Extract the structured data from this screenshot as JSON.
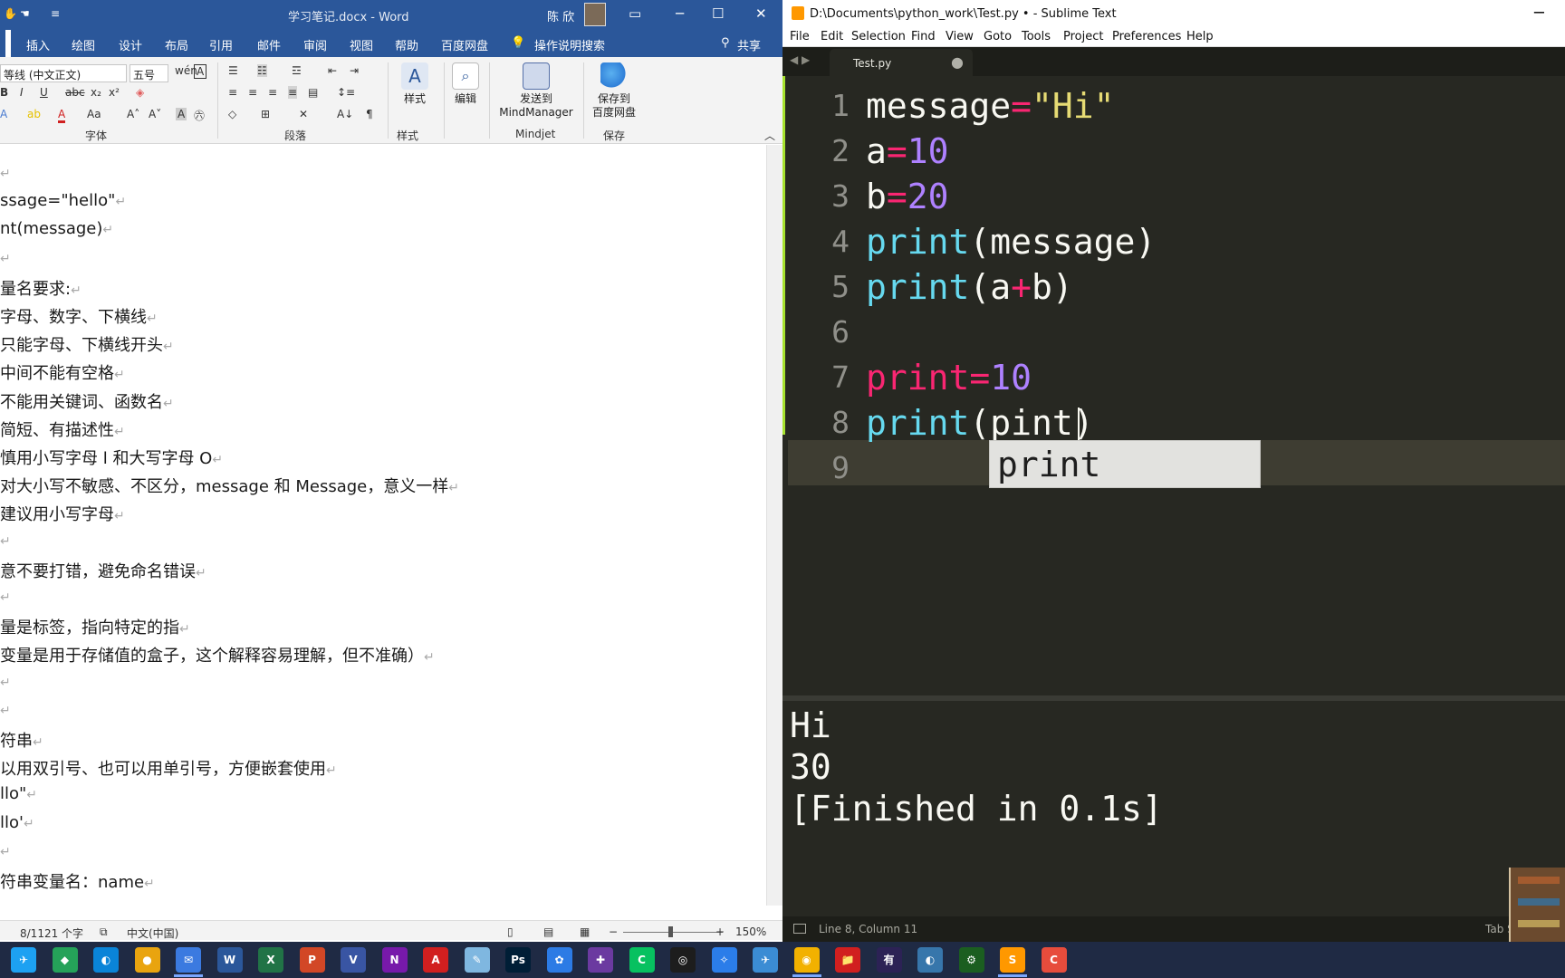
{
  "word": {
    "title": "学习笔记.docx  -  Word",
    "user": "陈 欣",
    "tabs": [
      "插入",
      "绘图",
      "设计",
      "布局",
      "引用",
      "邮件",
      "审阅",
      "视图",
      "帮助",
      "百度网盘",
      "操作说明搜索",
      "共享"
    ],
    "ribbon": {
      "font_name": "等线 (中文正文)",
      "font_size": "五号",
      "group_font": "字体",
      "group_paragraph": "段落",
      "group_styles": "样式",
      "styles_btn": "样式",
      "edit_btn": "编辑",
      "mindmanager_btn_line1": "发送到",
      "mindmanager_btn_line2": "MindManager",
      "group_mindjet": "Mindjet",
      "baidu_btn_line1": "保存到",
      "baidu_btn_line2": "百度网盘",
      "group_save": "保存"
    },
    "doc_lines": [
      "",
      "ssage=\"hello\"",
      "nt(message)",
      "",
      "量名要求:",
      "  字母、数字、下横线",
      "  只能字母、下横线开头",
      "  中间不能有空格",
      "  不能用关键词、函数名",
      "  简短、有描述性",
      "  慎用小写字母 l 和大写字母 O",
      "  对大小写不敏感、不区分，message 和 Message，意义一样",
      "  建议用小写字母",
      "",
      "意不要打错，避免命名错误",
      "",
      "量是标签，指向特定的指",
      "变量是用于存储值的盒子，这个解释容易理解，但不准确）",
      "",
      "",
      "符串",
      "以用双引号、也可以用单引号，方便嵌套使用",
      "llo\"",
      "llo'",
      "",
      "符串变量名：name"
    ],
    "status": {
      "words": "8/1121 个字",
      "lang": "中文(中国)",
      "zoom": "150%",
      "zoom_minus": "−",
      "zoom_plus": "+"
    }
  },
  "sublime": {
    "title": "D:\\Documents\\python_work\\Test.py • - Sublime Text",
    "menu": [
      "File",
      "Edit",
      "Selection",
      "Find",
      "View",
      "Goto",
      "Tools",
      "Project",
      "Preferences",
      "Help"
    ],
    "tab_name": "Test.py",
    "tab_dirty": "●",
    "line_numbers": [
      "1",
      "2",
      "3",
      "4",
      "5",
      "6",
      "7",
      "8",
      "9"
    ],
    "autocomplete": "print",
    "output": [
      "Hi",
      "30",
      "[Finished in 0.1s]"
    ],
    "status_text": "Line 8, Column 11",
    "status_tab": "Tab S"
  },
  "code_tokens": {
    "l1": [
      "message",
      "=",
      "\"Hi\""
    ],
    "l2": [
      "a",
      "=",
      "10"
    ],
    "l3": [
      "b",
      "=",
      "20"
    ],
    "l4": [
      "print",
      "(message)"
    ],
    "l5": [
      "print",
      "(a",
      "+",
      "b)"
    ],
    "l7": [
      "print",
      "=",
      "10"
    ],
    "l8": [
      "print",
      "(pint",
      ")"
    ]
  },
  "colors": {
    "word_blue": "#2b579a",
    "monokai_bg": "#272822",
    "monokai_pink": "#f92672",
    "monokai_purple": "#ae81ff",
    "monokai_cyan": "#66d9ef",
    "monokai_yellow": "#e6db74",
    "monokai_green": "#a6e22e"
  },
  "taskbar": {
    "apps": [
      "twitter-like-icon",
      "edge-icon",
      "chrome-icon",
      "mail-icon",
      "word-icon",
      "excel-icon",
      "powerpoint-icon",
      "visio-icon",
      "onenote-icon",
      "acrobat-icon",
      "notepad-icon",
      "photoshop-icon",
      "paint-icon",
      "visualstudio-icon",
      "camtasia-icon",
      "wechat-icon",
      "qq-icon",
      "feishu-icon",
      "browser-icon",
      "explorer-icon",
      "youdao-icon",
      "eclipse-icon",
      "python-icon",
      "idle-icon",
      "sublime-icon",
      "camtasia-rec-icon"
    ],
    "youdao_label": "有道"
  }
}
